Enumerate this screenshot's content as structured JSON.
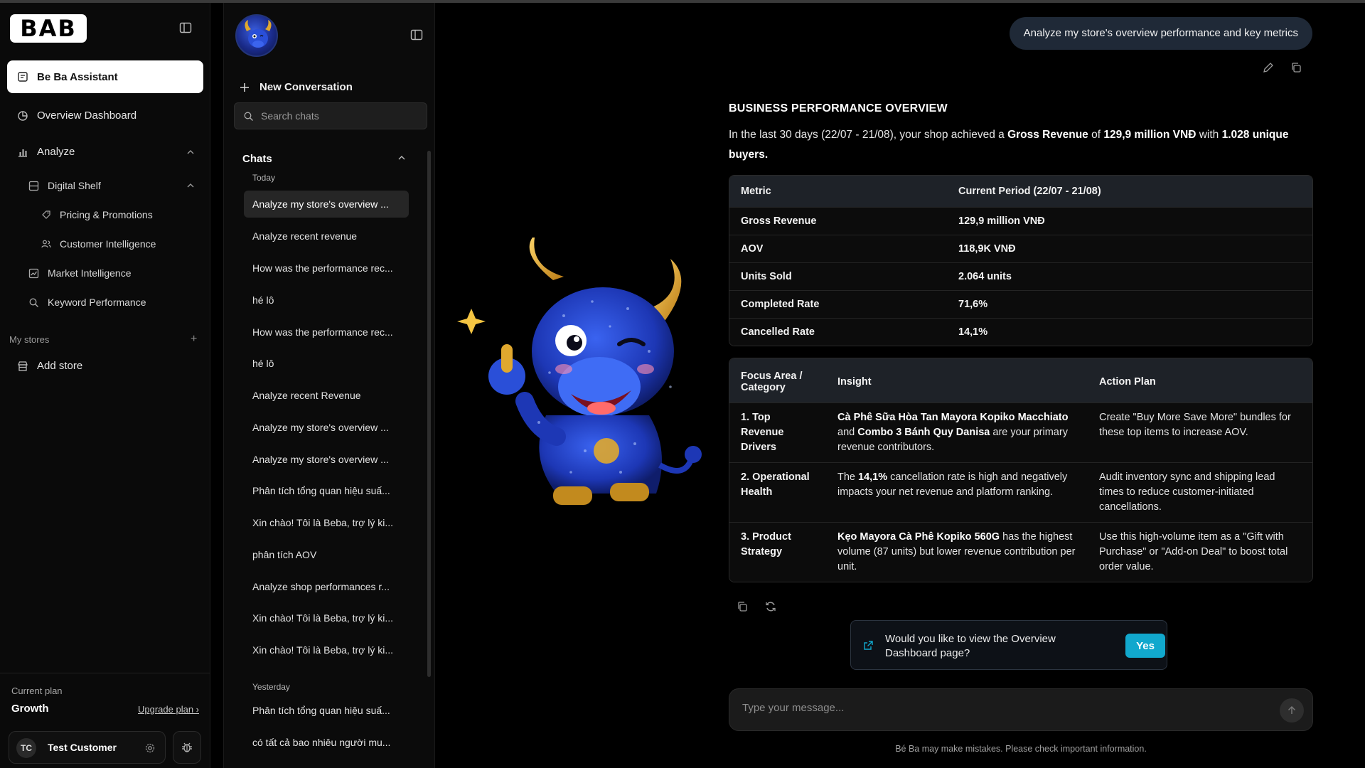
{
  "app": {
    "logo_text": "BAB"
  },
  "nav": {
    "items": [
      {
        "label": "Be Ba Assistant",
        "icon": "assistant-icon"
      },
      {
        "label": "Overview Dashboard",
        "icon": "pie-chart-icon"
      },
      {
        "label": "Analyze",
        "icon": "bar-chart-icon"
      },
      {
        "label": "Digital Shelf",
        "icon": "shelf-icon"
      },
      {
        "label": "Pricing & Promotions",
        "icon": "tag-icon"
      },
      {
        "label": "Customer Intelligence",
        "icon": "users-icon"
      },
      {
        "label": "Market Intelligence",
        "icon": "line-chart-icon"
      },
      {
        "label": "Keyword Performance",
        "icon": "search-icon"
      }
    ],
    "stores_label": "My stores",
    "add_store": "Add store",
    "plan_label": "Current plan",
    "plan_name": "Growth",
    "upgrade": "Upgrade plan ›",
    "user_initials": "TC",
    "user_name": "Test Customer"
  },
  "chats": {
    "new_conversation": "New Conversation",
    "search_placeholder": "Search chats",
    "header": "Chats",
    "today_label": "Today",
    "yesterday_label": "Yesterday",
    "today": [
      "Analyze my store's overview ...",
      "Analyze recent revenue",
      "How was the performance rec...",
      "hé lô",
      "How was the performance rec...",
      "hé lô",
      "Analyze recent Revenue",
      "Analyze my store's overview ...",
      "Analyze my store's overview ...",
      "Phân tích tổng quan hiệu suấ...",
      "Xin chào! Tôi là Beba, trợ lý ki...",
      "phân tích AOV",
      "Analyze shop performances r...",
      "Xin chào! Tôi là Beba, trợ lý ki...",
      "Xin chào! Tôi là Beba, trợ lý ki..."
    ],
    "yesterday": [
      "Phân tích tổng quan hiệu suấ...",
      "có tất cả bao nhiêu người mu..."
    ]
  },
  "conversation": {
    "user_message": "Analyze my store's overview performance and key metrics",
    "answer": {
      "title": "BUSINESS PERFORMANCE OVERVIEW",
      "intro_1": "In the last 30 days (22/07 - 21/08), your shop achieved a ",
      "intro_b1": "Gross Revenue",
      "intro_2": " of ",
      "intro_b2": "129,9 million VNĐ",
      "intro_3": " with ",
      "intro_b3": "1.028 unique buyers.",
      "metrics_headers": [
        "Metric",
        "Current Period (22/07 - 21/08)"
      ],
      "metrics": [
        {
          "metric": "Gross Revenue",
          "value": "129,9 million VNĐ"
        },
        {
          "metric": "AOV",
          "value": "118,9K VNĐ"
        },
        {
          "metric": "Units Sold",
          "value": "2.064 units"
        },
        {
          "metric": "Completed Rate",
          "value": "71,6%"
        },
        {
          "metric": "Cancelled Rate",
          "value": "14,1%"
        }
      ],
      "focus_headers": [
        "Focus Area / Category",
        "Insight",
        "Action Plan"
      ],
      "focus": [
        {
          "area": "1. Top Revenue Drivers",
          "insight_b1": "Cà Phê Sữa Hòa Tan Mayora Kopiko Macchiato",
          "insight_t1": " and ",
          "insight_b2": "Combo 3 Bánh Quy Danisa",
          "insight_t2": " are your primary revenue contributors.",
          "action": "Create \"Buy More Save More\" bundles for these top items to increase AOV."
        },
        {
          "area": "2. Operational Health",
          "insight_t0": "The ",
          "insight_b1": "14,1%",
          "insight_t1": " cancellation rate is high and negatively impacts your net revenue and platform ranking.",
          "action": "Audit inventory sync and shipping lead times to reduce customer-initiated cancellations."
        },
        {
          "area": "3. Product Strategy",
          "insight_b1": "Kẹo Mayora Cà Phê Kopiko 560G",
          "insight_t1": " has the highest volume (87 units) but lower revenue contribution per unit.",
          "action": "Use this high-volume item as a \"Gift with Purchase\" or \"Add-on Deal\" to boost total order value."
        }
      ]
    },
    "suggestion": "Would you like to view the Overview Dashboard page?",
    "suggestion_yes": "Yes",
    "composer_placeholder": "Type your message...",
    "disclaimer": "Bé Ba may make mistakes. Please check important information."
  },
  "colors": {
    "accent": "#11a8cd",
    "bubble": "#1f2937",
    "mascot_blue": "#1f3fbf",
    "horn_gold": "#e0a82e"
  }
}
